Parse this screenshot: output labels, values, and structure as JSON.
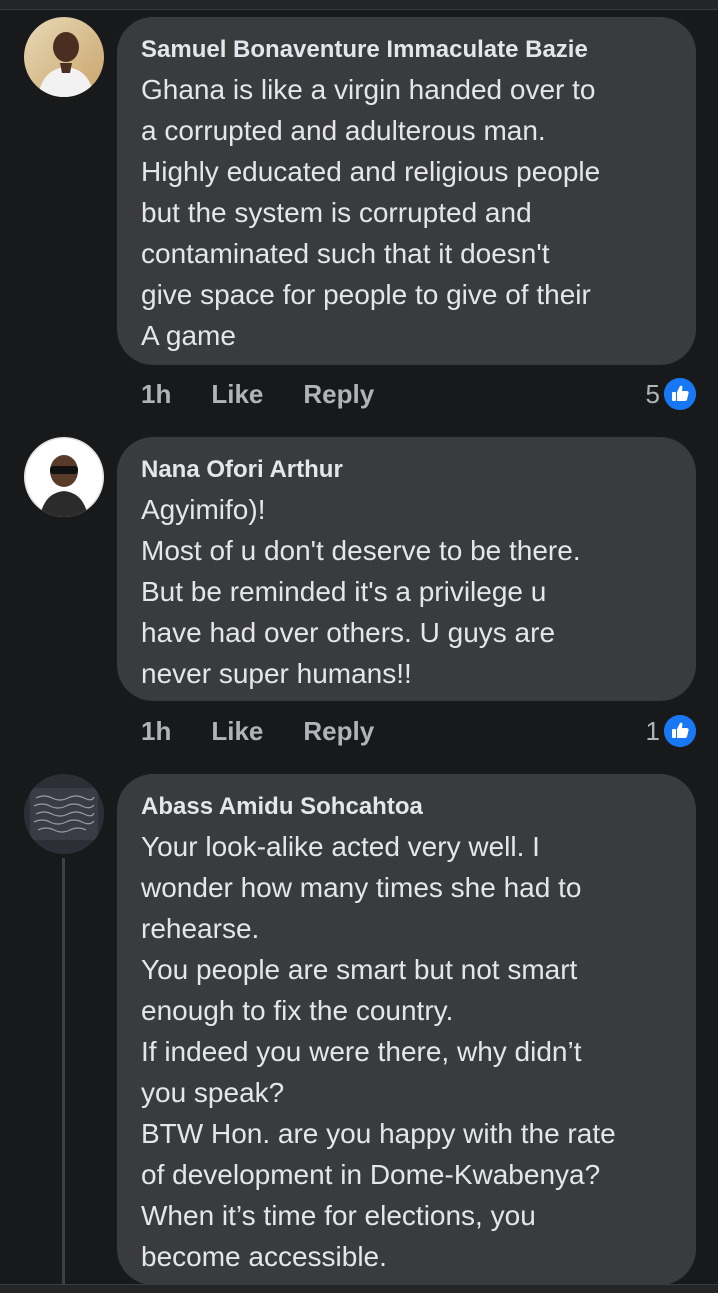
{
  "comments": [
    {
      "author": "Samuel Bonaventure Immaculate Bazie",
      "lines": [
        "Ghana is like a virgin handed over to",
        "a corrupted and adulterous man.",
        "Highly educated and religious people",
        "but the system is corrupted  and",
        "contaminated such that  it doesn't",
        "give space for people to give of their",
        "A game"
      ],
      "time": "1h",
      "like_label": "Like",
      "reply_label": "Reply",
      "reaction_count": "5"
    },
    {
      "author": "Nana Ofori Arthur",
      "lines": [
        "Agyimifo)!",
        "Most of u don't deserve to be there.",
        "But be reminded it's a privilege u",
        "have had over others. U guys are",
        "never super humans!!"
      ],
      "time": "1h",
      "like_label": "Like",
      "reply_label": "Reply",
      "reaction_count": "1"
    },
    {
      "author": "Abass Amidu Sohcahtoa",
      "lines": [
        "Your look-alike acted very well. I",
        "wonder how many times she had to",
        "rehearse.",
        "You people are smart but not smart",
        "enough to fix the country.",
        "If indeed you were there, why didn’t",
        "you speak?",
        "BTW Hon. are you happy with the rate",
        "of development in Dome-Kwabenya?",
        "When it’s time for elections, you",
        "become accessible."
      ]
    }
  ],
  "colors": {
    "background": "#18191a",
    "bubble": "#3a3b3c",
    "text": "#e4e6eb",
    "secondary_text": "#b0b3b8",
    "like_blue": "#1877f2"
  },
  "icons": {
    "like_reaction": "thumbs-up-icon"
  }
}
